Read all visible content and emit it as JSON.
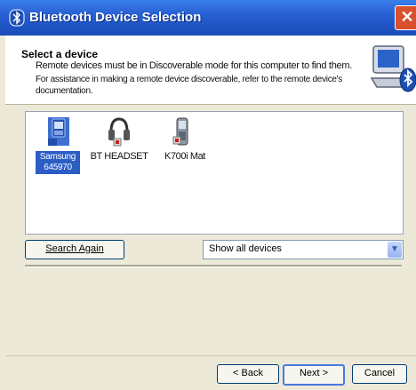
{
  "window": {
    "title": "Bluetooth Device Selection",
    "close_glyph": "✕"
  },
  "header": {
    "title": "Select a device",
    "line1": "Remote devices must be in Discoverable mode for this computer to find them.",
    "line2": "For assistance in making a remote device discoverable, refer to the remote device's documentation."
  },
  "devices": [
    {
      "label": "Samsung 645970",
      "icon": "phone-icon",
      "selected": true
    },
    {
      "label": "BT HEADSET",
      "icon": "headset-icon",
      "selected": false
    },
    {
      "label": "K700i Mat",
      "icon": "mobile-phone-icon",
      "selected": false
    }
  ],
  "controls": {
    "search_again_label": "Search Again",
    "filter_value": "Show all devices"
  },
  "buttons": {
    "back": "< Back",
    "next": "Next >",
    "cancel": "Cancel"
  },
  "colors": {
    "titlebar": "#245edb",
    "selection": "#2b5dc4",
    "background": "#ece9d8"
  }
}
